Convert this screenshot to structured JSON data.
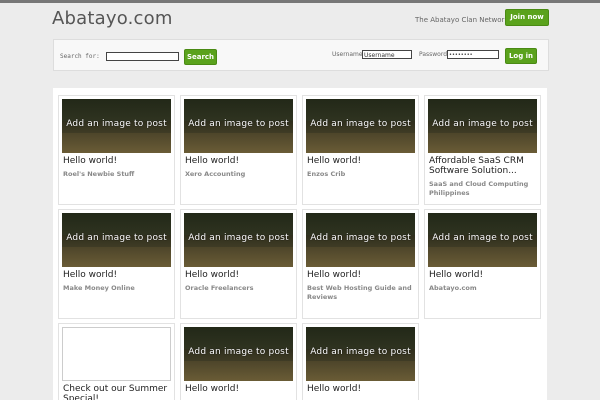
{
  "header": {
    "logo": "Abatayo.com",
    "network": "The Abatayo Clan Network",
    "join_label": "Join now"
  },
  "searchbar": {
    "search_label": "Search for:",
    "search_value": "",
    "search_button": "Search",
    "username_label": "Username",
    "username_value": "Username",
    "password_label": "Password",
    "password_value": "••••••••",
    "login_button": "Log in"
  },
  "placeholder_text": "Add an image to post",
  "cards": [
    {
      "title": "Hello world!",
      "meta": "Roel's Newbie Stuff"
    },
    {
      "title": "Hello world!",
      "meta": "Xero Accounting"
    },
    {
      "title": "Hello world!",
      "meta": "Enzos Crib"
    },
    {
      "title": "Affordable SaaS CRM Software Solution...",
      "meta": "SaaS and Cloud Computing Philippines"
    },
    {
      "title": "Hello world!",
      "meta": "Make Money Online"
    },
    {
      "title": "Hello world!",
      "meta": "Oracle Freelancers"
    },
    {
      "title": "Hello world!",
      "meta": "Best Web Hosting Guide and Reviews"
    },
    {
      "title": "Hello world!",
      "meta": "Abatayo.com"
    },
    {
      "title": "Check out our Summer Special!",
      "meta": ""
    },
    {
      "title": "Hello world!",
      "meta": ""
    },
    {
      "title": "Hello world!",
      "meta": ""
    }
  ]
}
